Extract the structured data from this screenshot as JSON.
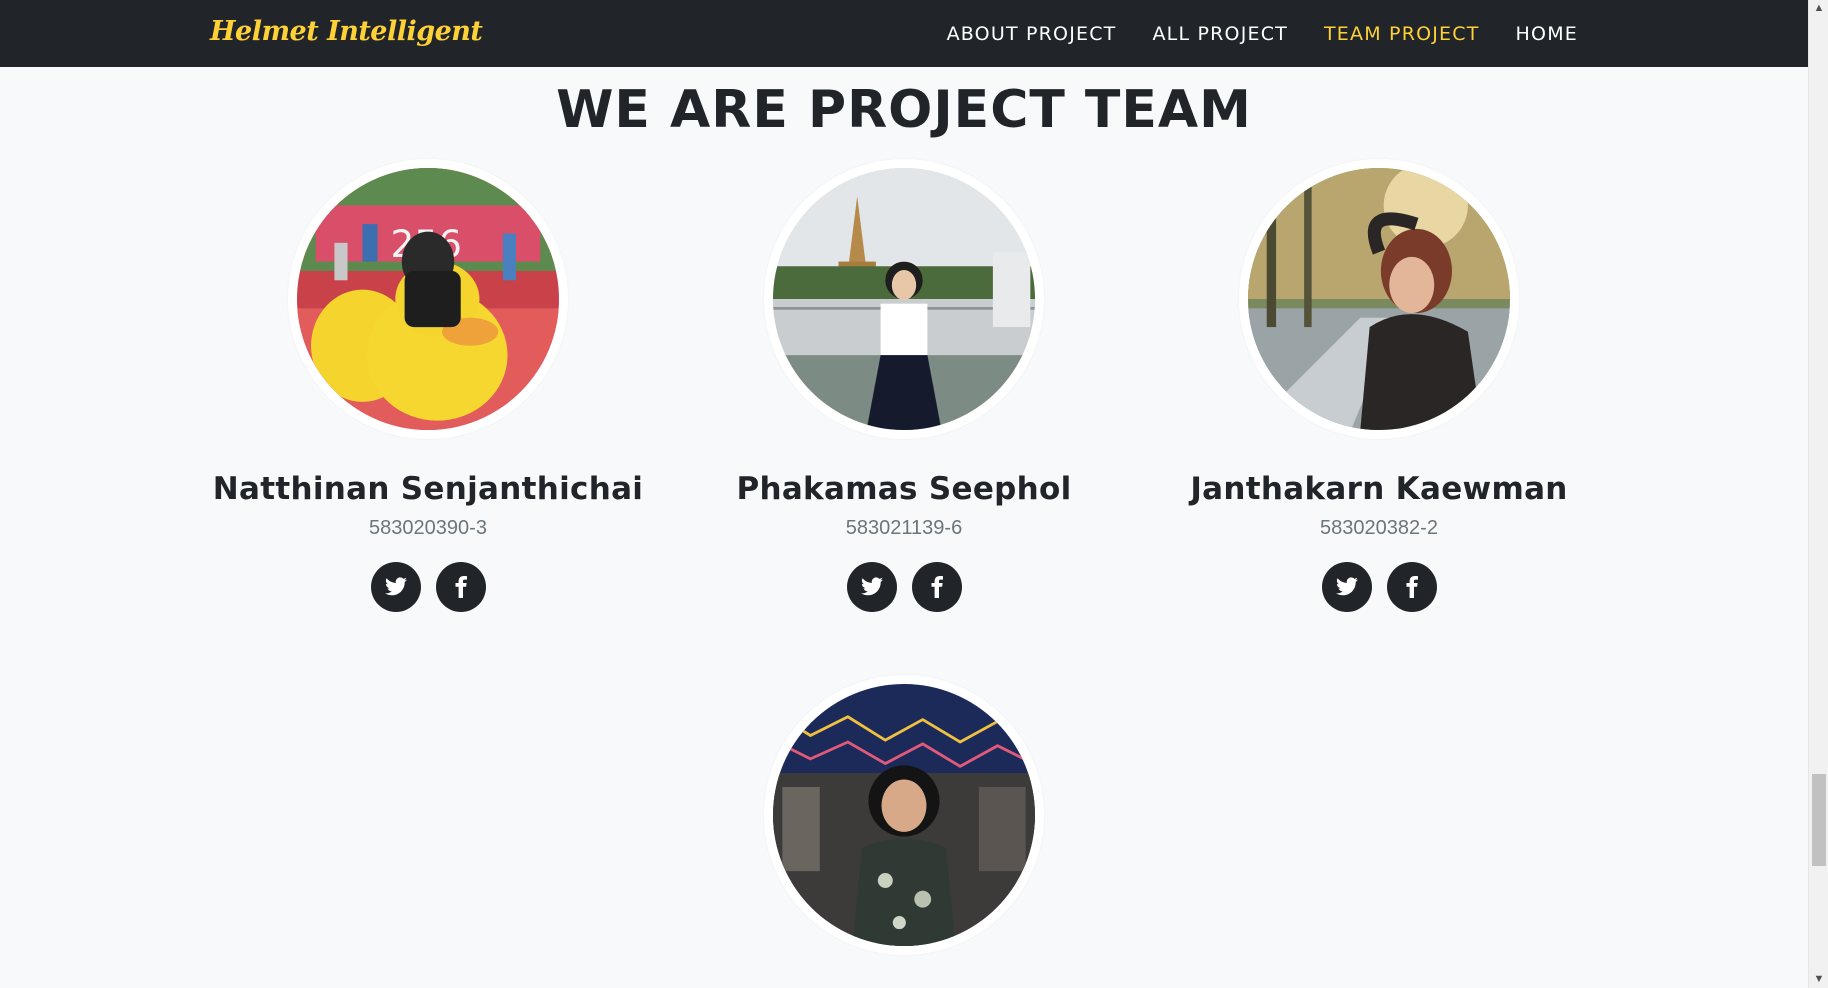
{
  "brand": "Helmet Intelligent",
  "nav": {
    "items": [
      {
        "label": "ABOUT PROJECT"
      },
      {
        "label": "ALL PROJECT"
      },
      {
        "label": "TEAM PROJECT",
        "active": true
      },
      {
        "label": "HOME"
      }
    ]
  },
  "team": {
    "title": "WE ARE PROJECT TEAM",
    "members": [
      {
        "name": "Natthinan Senjanthichai",
        "id": "583020390-3",
        "photo": "rubber-duck-festival-photo"
      },
      {
        "name": "Phakamas Seephol",
        "id": "583021139-6",
        "photo": "bridge-pagoda-photo"
      },
      {
        "name": "Janthakarn Kaewman",
        "id": "583020382-2",
        "photo": "park-sunlight-photo"
      },
      {
        "name": "",
        "id": "",
        "photo": "night-market-photo"
      }
    ]
  },
  "icons": {
    "twitter": "twitter-icon",
    "facebook": "facebook-icon"
  },
  "colors": {
    "navbar": "#212529",
    "accent": "#fed136",
    "background": "#f8f9fa",
    "text": "#212529",
    "muted": "#6c757d"
  }
}
